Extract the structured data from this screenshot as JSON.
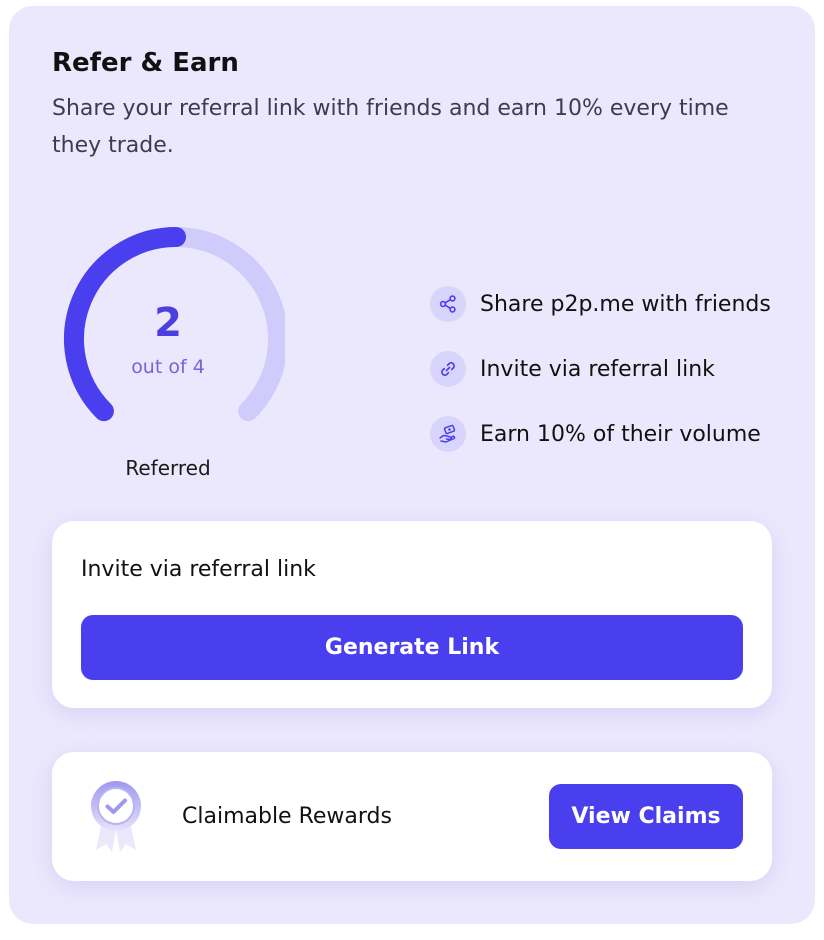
{
  "header": {
    "title": "Refer & Earn",
    "subtitle": "Share your referral link with friends and earn 10% every time they trade."
  },
  "progress": {
    "referred_count": "2",
    "out_of_text": "out of 4",
    "referred": 2,
    "total": 4,
    "label": "Referred"
  },
  "features": [
    {
      "icon": "share-icon",
      "text": "Share p2p.me with friends"
    },
    {
      "icon": "link-icon",
      "text": "Invite via referral link"
    },
    {
      "icon": "hand-money-icon",
      "text": "Earn 10% of their volume"
    }
  ],
  "invite": {
    "label": "Invite via referral link",
    "button_label": "Generate Link"
  },
  "rewards": {
    "icon": "reward-badge-icon",
    "label": "Claimable Rewards",
    "button_label": "View Claims"
  },
  "colors": {
    "card_background": "#ebe8fd",
    "accent": "#4a3fee",
    "gauge_track": "#cfcbfa",
    "icon_circle": "#d9d4fb"
  }
}
